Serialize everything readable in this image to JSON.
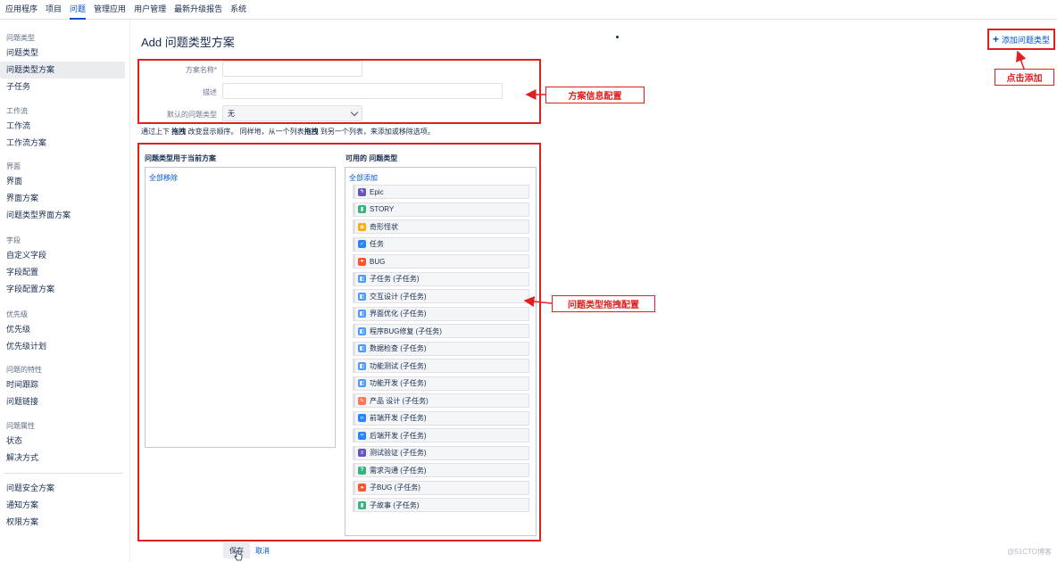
{
  "topnav": {
    "items": [
      "应用程序",
      "项目",
      "问题",
      "管理应用",
      "用户管理",
      "最新升级报告",
      "系统"
    ],
    "active_index": 2
  },
  "sidebar": {
    "groups": [
      {
        "head": "问题类型",
        "items": [
          "问题类型",
          "问题类型方案",
          "子任务"
        ]
      },
      {
        "head": "工作流",
        "items": [
          "工作流",
          "工作流方案"
        ]
      },
      {
        "head": "界面",
        "items": [
          "界面",
          "界面方案",
          "问题类型界面方案"
        ]
      },
      {
        "head": "字段",
        "items": [
          "自定义字段",
          "字段配置",
          "字段配置方案"
        ]
      },
      {
        "head": "优先级",
        "items": [
          "优先级",
          "优先级计划"
        ]
      },
      {
        "head": "问题的特性",
        "items": [
          "时间跟踪",
          "问题链接"
        ]
      },
      {
        "head": "问题属性",
        "items": [
          "状态",
          "解决方式"
        ]
      },
      {
        "head": "",
        "items": [
          "问题安全方案",
          "通知方案",
          "权限方案"
        ]
      }
    ],
    "active_item": "问题类型方案"
  },
  "page": {
    "title": "Add 问题类型方案",
    "add_button": "添加问题类型"
  },
  "form": {
    "name_label": "方案名称*",
    "name_value": "",
    "desc_label": "描述",
    "desc_value": "",
    "default_label": "默认的问题类型",
    "default_value": "无"
  },
  "hint": {
    "p1": "通过上下 ",
    "b1": "拖拽",
    "p2": " 改变显示顺序。 同样地，从一个列表",
    "b2": "拖拽",
    "p3": " 到另一个列表，来添加或移除选项。"
  },
  "left_list": {
    "title": "问题类型用于当前方案",
    "remove_all": "全部移除"
  },
  "right_list": {
    "title": "可用的 问题类型",
    "add_all": "全部添加",
    "items": [
      {
        "label": "Epic",
        "color": "#6554c0",
        "icon": "lightning-icon"
      },
      {
        "label": "STORY",
        "color": "#36b37e",
        "icon": "bookmark-icon"
      },
      {
        "label": "奇形怪状",
        "color": "#ffab00",
        "icon": "strange-icon"
      },
      {
        "label": "任务",
        "color": "#2684ff",
        "icon": "checkbox-icon"
      },
      {
        "label": "BUG",
        "color": "#ff5630",
        "icon": "bug-icon"
      },
      {
        "label": "子任务 (子任务)",
        "color": "#4c9aff",
        "icon": "subtask-icon"
      },
      {
        "label": "交互设计 (子任务)",
        "color": "#4c9aff",
        "icon": "subtask-icon"
      },
      {
        "label": "界面优化 (子任务)",
        "color": "#4c9aff",
        "icon": "subtask-icon"
      },
      {
        "label": "程序BUG修复 (子任务)",
        "color": "#4c9aff",
        "icon": "subtask-icon"
      },
      {
        "label": "数据检查 (子任务)",
        "color": "#4c9aff",
        "icon": "subtask-icon"
      },
      {
        "label": "功能测试 (子任务)",
        "color": "#4c9aff",
        "icon": "subtask-icon"
      },
      {
        "label": "功能开发 (子任务)",
        "color": "#4c9aff",
        "icon": "subtask-icon"
      },
      {
        "label": "产品 设计 (子任务)",
        "color": "#ff7452",
        "icon": "design-icon"
      },
      {
        "label": "前端开发 (子任务)",
        "color": "#2684ff",
        "icon": "code-icon"
      },
      {
        "label": "后端开发 (子任务)",
        "color": "#2684ff",
        "icon": "code-icon"
      },
      {
        "label": "测试验证 (子任务)",
        "color": "#6554c0",
        "icon": "document-icon"
      },
      {
        "label": "需求沟通 (子任务)",
        "color": "#36b37e",
        "icon": "question-icon"
      },
      {
        "label": "子BUG (子任务)",
        "color": "#ff5630",
        "icon": "bug-icon"
      },
      {
        "label": "子故事 (子任务)",
        "color": "#36b37e",
        "icon": "bookmark-icon"
      }
    ]
  },
  "callouts": {
    "info": "方案信息配置",
    "drag": "问题类型拖拽配置",
    "add": "点击添加"
  },
  "footer": {
    "save": "保存",
    "cancel": "取消"
  },
  "colors": {
    "accent": "#0052cc",
    "annotation": "#e02020"
  }
}
